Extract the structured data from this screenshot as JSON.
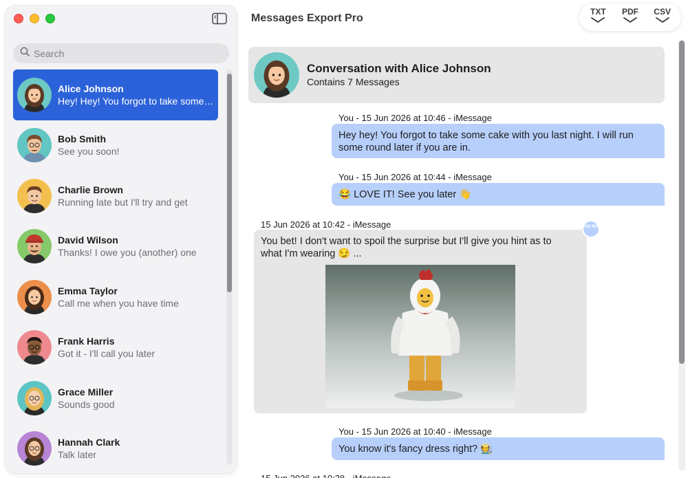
{
  "app": {
    "title": "Messages Export Pro"
  },
  "search": {
    "placeholder": "Search"
  },
  "exports": [
    {
      "label": "TXT"
    },
    {
      "label": "PDF"
    },
    {
      "label": "CSV"
    }
  ],
  "contacts": [
    {
      "name": "Alice Johnson",
      "preview": "Hey! Hey! You forgot to take some cake with you last night.",
      "avatar_bg": "#6ec9c4",
      "selected": true
    },
    {
      "name": "Bob Smith",
      "preview": "See you soon!",
      "avatar_bg": "#62c6c3"
    },
    {
      "name": "Charlie Brown",
      "preview": "Running late but I'll try and get",
      "avatar_bg": "#f3c04f"
    },
    {
      "name": "David Wilson",
      "preview": "Thanks! I owe you (another) one",
      "avatar_bg": "#86c96a"
    },
    {
      "name": "Emma Taylor",
      "preview": "Call me when you have time",
      "avatar_bg": "#ec8f4a"
    },
    {
      "name": "Frank Harris",
      "preview": "Got it - I'll call you later",
      "avatar_bg": "#ee8a8f"
    },
    {
      "name": "Grace Miller",
      "preview": "Sounds good",
      "avatar_bg": "#5cc5c4"
    },
    {
      "name": "Hannah Clark",
      "preview": "Talk later",
      "avatar_bg": "#b784d6"
    }
  ],
  "conversation": {
    "title": "Conversation with Alice Johnson",
    "subtitle": "Contains 7 Messages",
    "messages": [
      {
        "meta": "You - 15 Jun 2026 at 10:46 - iMessage",
        "text": "Hey hey! You forgot to take some cake with you last night. I will run some round later if you are in.",
        "direction": "out"
      },
      {
        "meta": "You - 15 Jun 2026 at 10:44 - iMessage",
        "text": "😂 LOVE IT! See you later 👋",
        "direction": "out"
      },
      {
        "meta": "15 Jun 2026 at 10:42 - iMessage",
        "text": "You bet! I don't want to spoil the surprise but I'll give you hint as to what I'm wearing 😏 ...",
        "direction": "in",
        "tapback": "HA HA",
        "has_photo": true
      },
      {
        "meta": "You - 15 Jun 2026 at 10:40 - iMessage",
        "text": "You know it's fancy dress right? 🧑‍🌾",
        "direction": "out"
      },
      {
        "meta": "15 Jun 2026 at 10:38 - iMessage",
        "text": "",
        "direction": "in"
      }
    ]
  },
  "colors": {
    "selected_row": "#2c62d9",
    "outgoing_bubble": "#b7d0fb",
    "incoming_bubble": "#e6e6e6"
  },
  "icons": [
    "sidebar-toggle-icon",
    "search-icon",
    "chevron-down-icon"
  ]
}
